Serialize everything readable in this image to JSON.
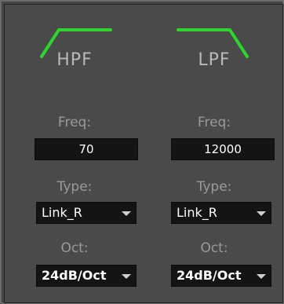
{
  "hpf": {
    "title": "HPF",
    "freq_label": "Freq:",
    "freq_value": "70",
    "type_label": "Type:",
    "type_value": "Link_R",
    "oct_label": "Oct:",
    "oct_value": "24dB/Oct",
    "curve_icon": "highpass-curve-icon"
  },
  "lpf": {
    "title": "LPF",
    "freq_label": "Freq:",
    "freq_value": "12000",
    "type_label": "Type:",
    "type_value": "Link_R",
    "oct_label": "Oct:",
    "oct_value": "24dB/Oct",
    "curve_icon": "lowpass-curve-icon"
  },
  "colors": {
    "curve": "#2fd52f",
    "panel_bg": "#4a4a4a",
    "field_bg": "#141414",
    "label_text": "#9a9a9a",
    "value_text": "#ffffff"
  }
}
